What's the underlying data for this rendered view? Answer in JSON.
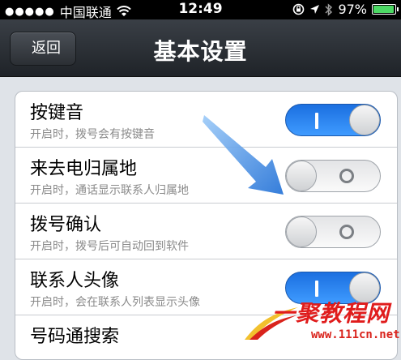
{
  "status_bar": {
    "carrier": "中国联通",
    "time": "12:49",
    "battery_percent": "97%",
    "battery_level": 0.97,
    "icons": [
      "signal-dots-icon",
      "wifi-icon",
      "rotation-lock-icon",
      "location-icon",
      "bluetooth-icon",
      "battery-icon"
    ]
  },
  "nav": {
    "back_label": "返回",
    "title": "基本设置"
  },
  "settings": [
    {
      "label": "按键音",
      "desc": "开启时，拨号会有按键音",
      "on": true
    },
    {
      "label": "来去电归属地",
      "desc": "开启时，通话显示联系人归属地",
      "on": false
    },
    {
      "label": "拨号确认",
      "desc": "开启时，拨号后可自动回到软件",
      "on": false
    },
    {
      "label": "联系人头像",
      "desc": "开启时，会在联系人列表显示头像",
      "on": true
    },
    {
      "label": "号码通搜索",
      "desc": "",
      "on": null
    }
  ],
  "watermark": {
    "text": "一聚教程网",
    "url": "www.111cn.net"
  },
  "colors": {
    "toggle_on": "#2f86f5",
    "nav_bg": "#2b2f34",
    "annotation_arrow": "#2a7de1",
    "watermark_red": "#e01c1c"
  }
}
